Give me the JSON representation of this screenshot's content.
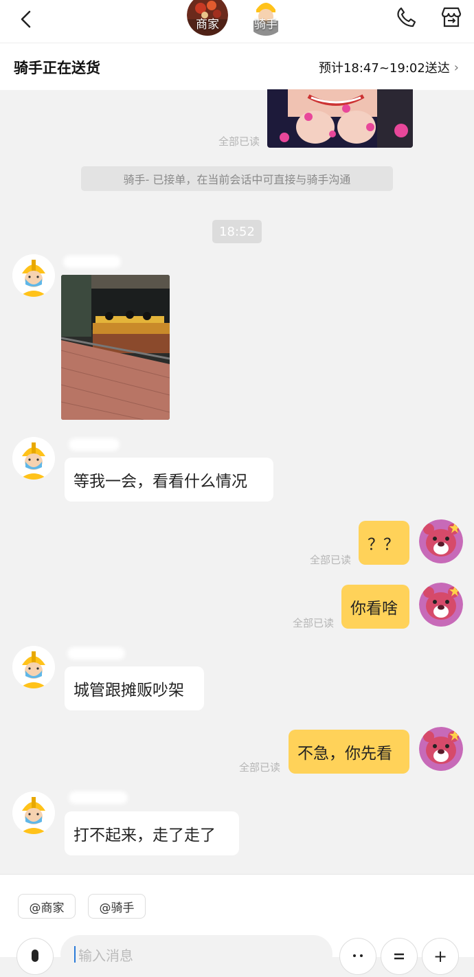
{
  "header": {
    "merchant_label": "商家",
    "rider_label": "骑手"
  },
  "status": {
    "title": "骑手正在送货",
    "eta": "预计18:47~19:02送达"
  },
  "chat": {
    "read_label_top": "全部已读",
    "system_notice": "骑手-        已接单，在当前会话中可直接与骑手沟通",
    "timestamp": "18:52",
    "messages": [
      {
        "from": "rider",
        "text": "等我一会，看看什么情况"
      },
      {
        "from": "me",
        "text": "？？",
        "read": "全部已读"
      },
      {
        "from": "me",
        "text": "你看啥",
        "read": "全部已读"
      },
      {
        "from": "rider",
        "text": "城管跟摊贩吵架"
      },
      {
        "from": "me",
        "text": "不急，你先看",
        "read": "全部已读"
      },
      {
        "from": "rider",
        "text": "打不起来，走了走了"
      }
    ]
  },
  "bottom": {
    "at_merchant": "@商家",
    "at_rider": "@骑手",
    "input_placeholder": "输入消息"
  },
  "colors": {
    "accent": "#ffd259",
    "background": "#f2f2f2"
  }
}
